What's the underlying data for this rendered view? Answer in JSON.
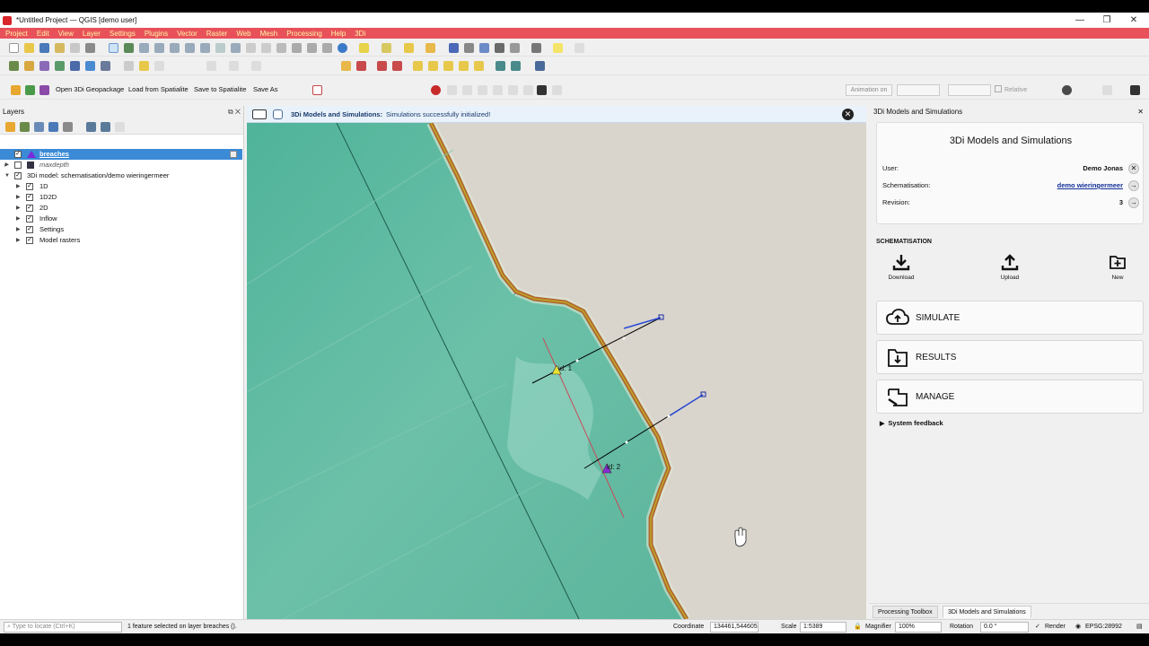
{
  "window": {
    "title": "*Untitled Project — QGIS [demo user]",
    "min": "—",
    "max": "❐",
    "close": "✕"
  },
  "menu": [
    "Project",
    "Edit",
    "View",
    "Layer",
    "Settings",
    "Plugins",
    "Vector",
    "Raster",
    "Web",
    "Mesh",
    "Processing",
    "Help",
    "3Di"
  ],
  "plugin_toolbar": {
    "open_gpkg": "Open 3Di Geopackage",
    "load_spatialite": "Load from Spatialite",
    "save_spatialite": "Save to Spatialite",
    "save_as": "Save As",
    "animation": "Animation on",
    "relative": "Relative"
  },
  "layers_panel": {
    "title": "Layers",
    "rows": [
      {
        "label": "breaches",
        "checked": "✓"
      },
      {
        "label": "maxdepth",
        "checked": ""
      },
      {
        "label": "3Di model: schematisation/demo wieringermeer",
        "checked": "✓"
      },
      {
        "label": "1D",
        "checked": "✓"
      },
      {
        "label": "1D2D",
        "checked": "✓"
      },
      {
        "label": "2D",
        "checked": "✓"
      },
      {
        "label": "Inflow",
        "checked": "✓"
      },
      {
        "label": "Settings",
        "checked": "✓"
      },
      {
        "label": "Model rasters",
        "checked": "✓"
      }
    ]
  },
  "message_bar": {
    "title": "3Di Models and Simulations:",
    "text": "Simulations successfully initialized!",
    "close": "✕"
  },
  "map": {
    "labels": {
      "id1": "id: 1",
      "id2": "id: 2"
    }
  },
  "right_panel": {
    "dock_title": "3Di Models and Simulations",
    "panel_title": "3Di Models and Simulations",
    "user_label": "User:",
    "user_value": "Demo Jonas",
    "schem_label": "Schematisation:",
    "schem_value": "demo wieringermeer",
    "rev_label": "Revision:",
    "rev_value": "3",
    "schematisation_header": "SCHEMATISATION",
    "download": "Download",
    "upload": "Upload",
    "new": "New",
    "simulate": "SIMULATE",
    "results": "RESULTS",
    "manage": "MANAGE",
    "system_feedback": "System feedback",
    "tabs": [
      "Processing Toolbox",
      "3Di Models and Simulations"
    ]
  },
  "status": {
    "locate_placeholder": "Type to locate (Ctrl+K)",
    "message": "1 feature selected on layer breaches ().",
    "coord_label": "Coordinate",
    "coord_value": "134461,544605",
    "scale_label": "Scale",
    "scale_value": "1:5389",
    "magnifier_label": "Magnifier",
    "magnifier_value": "100%",
    "rotation_label": "Rotation",
    "rotation_value": "0.0 °",
    "render_label": "Render",
    "crs": "EPSG:28992"
  },
  "colors": {
    "menubar": "#e8515a",
    "selection": "#3b8ad6",
    "link": "#12309a"
  }
}
